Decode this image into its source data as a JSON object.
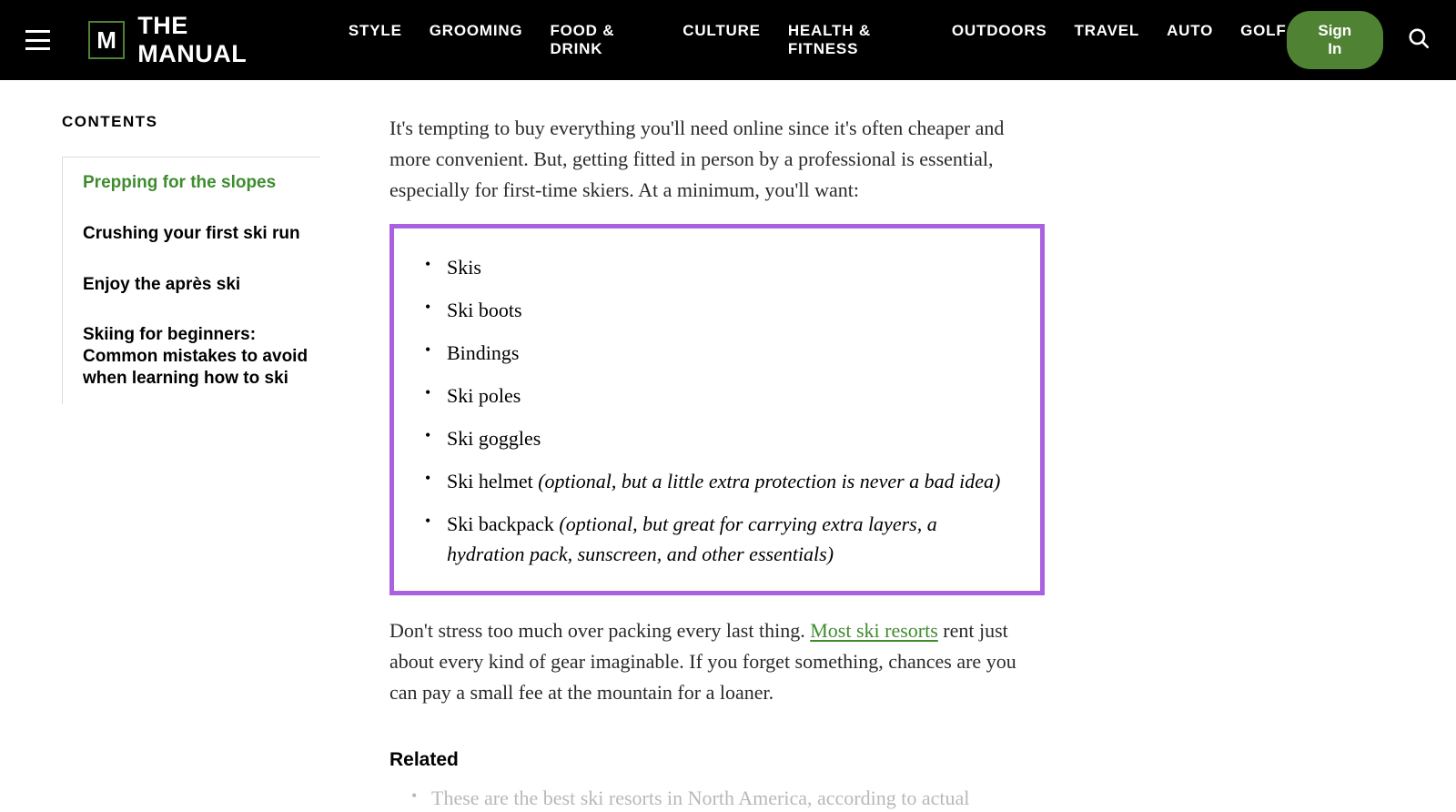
{
  "header": {
    "brand_glyph": "M",
    "brand_name": "THE MANUAL",
    "nav": [
      "STYLE",
      "GROOMING",
      "FOOD & DRINK",
      "CULTURE",
      "HEALTH & FITNESS",
      "OUTDOORS",
      "TRAVEL",
      "AUTO",
      "GOLF"
    ],
    "signin_label": "Sign In"
  },
  "toc": {
    "title": "CONTENTS",
    "items": [
      {
        "label": "Prepping for the slopes",
        "active": true
      },
      {
        "label": "Crushing your first ski run",
        "active": false
      },
      {
        "label": "Enjoy the après ski",
        "active": false
      },
      {
        "label": "Skiing for beginners: Common mistakes to avoid when learning how to ski",
        "active": false
      }
    ]
  },
  "article": {
    "para1": "It's tempting to buy everything you'll need online since it's often cheaper and more convenient. But, getting fitted in person by a professional is essential, especially for first-time skiers. At a minimum, you'll want:",
    "gear": [
      {
        "label": "Skis"
      },
      {
        "label": "Ski boots"
      },
      {
        "label": "Bindings"
      },
      {
        "label": "Ski poles"
      },
      {
        "label": "Ski goggles"
      },
      {
        "label": "Ski helmet ",
        "note": "(optional, but a little extra protection is never a bad idea)"
      },
      {
        "label": "Ski backpack ",
        "note": "(optional, but great for carrying extra layers, a hydration pack, sunscreen, and other essentials)"
      }
    ],
    "para2_pre": "Don't stress too much over packing every last thing. ",
    "para2_link": "Most ski resorts",
    "para2_post": " rent just about every kind of gear imaginable. If you forget something, chances are you can pay a small fee at the mountain for a loaner.",
    "related_heading": "Related",
    "related_items": [
      "These are the best ski resorts in North America, according to actual"
    ]
  }
}
